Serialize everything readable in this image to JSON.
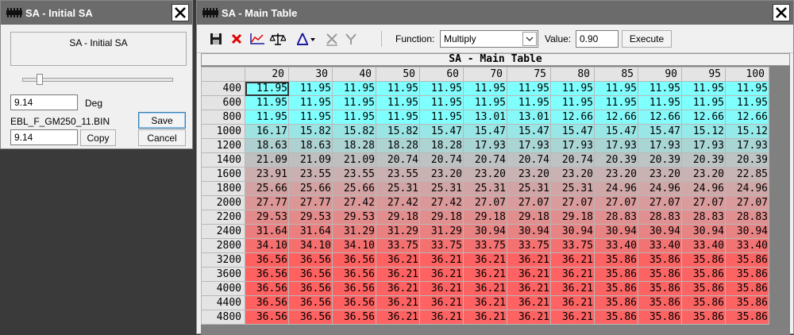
{
  "small_window": {
    "title": "SA - Initial SA",
    "label_box": "SA - Initial SA",
    "value1": "9.14",
    "unit": "Deg",
    "file_name": "EBL_F_GM250_11.BIN",
    "value2": "9.14",
    "save_label": "Save",
    "copy_label": "Copy",
    "cancel_label": "Cancel",
    "slider_fraction": 0.1
  },
  "main_window": {
    "title": "SA - Main Table",
    "toolbar": {
      "function_label": "Function:",
      "function_value": "Multiply",
      "value_label": "Value:",
      "value_input": "0.90",
      "execute_label": "Execute",
      "icons": [
        "save-icon",
        "delete-icon",
        "graph-icon",
        "balance-icon",
        "flatten-icon",
        "interpolate-x-icon",
        "interpolate-y-icon"
      ]
    },
    "table_title": "SA - Main Table",
    "columns": [
      "20",
      "30",
      "40",
      "50",
      "60",
      "70",
      "75",
      "80",
      "85",
      "90",
      "95",
      "100"
    ],
    "rows": [
      {
        "rpm": "400",
        "values": [
          "11.95",
          "11.95",
          "11.95",
          "11.95",
          "11.95",
          "11.95",
          "11.95",
          "11.95",
          "11.95",
          "11.95",
          "11.95",
          "11.95"
        ]
      },
      {
        "rpm": "600",
        "values": [
          "11.95",
          "11.95",
          "11.95",
          "11.95",
          "11.95",
          "11.95",
          "11.95",
          "11.95",
          "11.95",
          "11.95",
          "11.95",
          "11.95"
        ]
      },
      {
        "rpm": "800",
        "values": [
          "11.95",
          "11.95",
          "11.95",
          "11.95",
          "11.95",
          "13.01",
          "13.01",
          "12.66",
          "12.66",
          "12.66",
          "12.66",
          "12.66"
        ]
      },
      {
        "rpm": "1000",
        "values": [
          "16.17",
          "15.82",
          "15.82",
          "15.82",
          "15.47",
          "15.47",
          "15.47",
          "15.47",
          "15.47",
          "15.47",
          "15.12",
          "15.12"
        ]
      },
      {
        "rpm": "1200",
        "values": [
          "18.63",
          "18.63",
          "18.28",
          "18.28",
          "18.28",
          "17.93",
          "17.93",
          "17.93",
          "17.93",
          "17.93",
          "17.93",
          "17.93"
        ]
      },
      {
        "rpm": "1400",
        "values": [
          "21.09",
          "21.09",
          "21.09",
          "20.74",
          "20.74",
          "20.74",
          "20.74",
          "20.74",
          "20.39",
          "20.39",
          "20.39",
          "20.39"
        ]
      },
      {
        "rpm": "1600",
        "values": [
          "23.91",
          "23.55",
          "23.55",
          "23.55",
          "23.20",
          "23.20",
          "23.20",
          "23.20",
          "23.20",
          "23.20",
          "23.20",
          "22.85"
        ]
      },
      {
        "rpm": "1800",
        "values": [
          "25.66",
          "25.66",
          "25.66",
          "25.31",
          "25.31",
          "25.31",
          "25.31",
          "25.31",
          "24.96",
          "24.96",
          "24.96",
          "24.96"
        ]
      },
      {
        "rpm": "2000",
        "values": [
          "27.77",
          "27.77",
          "27.42",
          "27.42",
          "27.42",
          "27.07",
          "27.07",
          "27.07",
          "27.07",
          "27.07",
          "27.07",
          "27.07"
        ]
      },
      {
        "rpm": "2200",
        "values": [
          "29.53",
          "29.53",
          "29.53",
          "29.18",
          "29.18",
          "29.18",
          "29.18",
          "29.18",
          "28.83",
          "28.83",
          "28.83",
          "28.83"
        ]
      },
      {
        "rpm": "2400",
        "values": [
          "31.64",
          "31.64",
          "31.29",
          "31.29",
          "31.29",
          "30.94",
          "30.94",
          "30.94",
          "30.94",
          "30.94",
          "30.94",
          "30.94"
        ]
      },
      {
        "rpm": "2800",
        "values": [
          "34.10",
          "34.10",
          "34.10",
          "33.75",
          "33.75",
          "33.75",
          "33.75",
          "33.75",
          "33.40",
          "33.40",
          "33.40",
          "33.40"
        ]
      },
      {
        "rpm": "3200",
        "values": [
          "36.56",
          "36.56",
          "36.56",
          "36.21",
          "36.21",
          "36.21",
          "36.21",
          "36.21",
          "35.86",
          "35.86",
          "35.86",
          "35.86"
        ]
      },
      {
        "rpm": "3600",
        "values": [
          "36.56",
          "36.56",
          "36.56",
          "36.21",
          "36.21",
          "36.21",
          "36.21",
          "36.21",
          "35.86",
          "35.86",
          "35.86",
          "35.86"
        ]
      },
      {
        "rpm": "4000",
        "values": [
          "36.56",
          "36.56",
          "36.56",
          "36.21",
          "36.21",
          "36.21",
          "36.21",
          "36.21",
          "35.86",
          "35.86",
          "35.86",
          "35.86"
        ]
      },
      {
        "rpm": "4400",
        "values": [
          "36.56",
          "36.56",
          "36.56",
          "36.21",
          "36.21",
          "36.21",
          "36.21",
          "36.21",
          "35.86",
          "35.86",
          "35.86",
          "35.86"
        ]
      },
      {
        "rpm": "4800",
        "values": [
          "36.56",
          "36.56",
          "36.56",
          "36.21",
          "36.21",
          "36.21",
          "36.21",
          "36.21",
          "35.86",
          "35.86",
          "35.86",
          "35.86"
        ]
      }
    ],
    "color_scale": {
      "low": "#80ffff",
      "mid": "#c0c0c0",
      "high": "#ff6060"
    },
    "selected_cell": "400 / 20"
  }
}
